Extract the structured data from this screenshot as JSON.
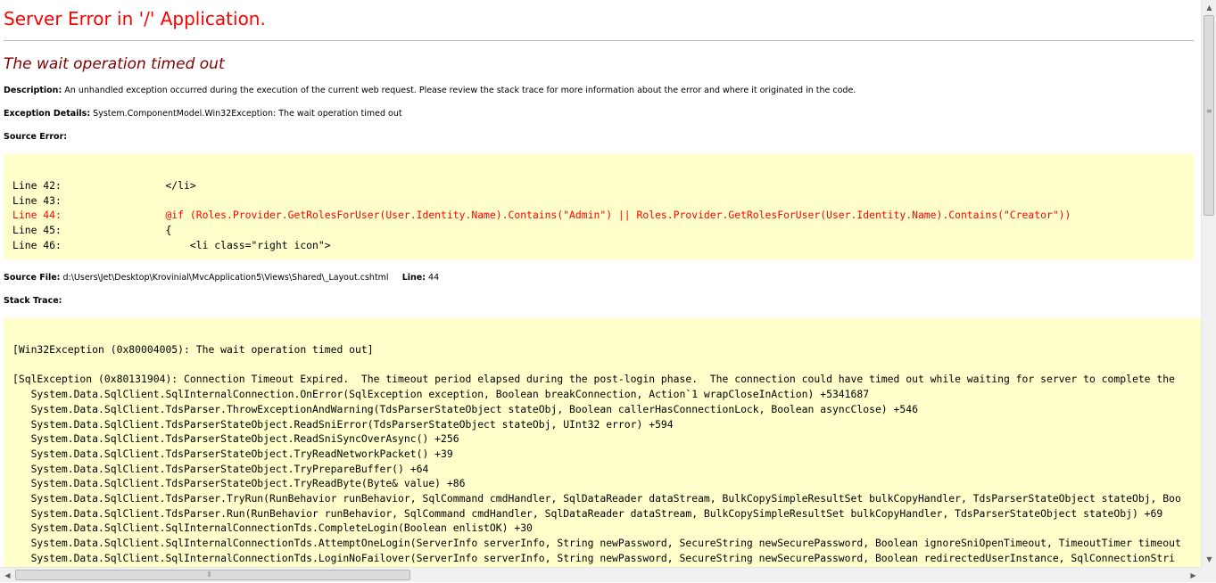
{
  "error": {
    "heading": "Server Error in '/' Application.",
    "subheading": "The wait operation timed out",
    "description_label": "Description:",
    "description_text": "An unhandled exception occurred during the execution of the current web request. Please review the stack trace for more information about the error and where it originated in the code.",
    "exception_label": "Exception Details:",
    "exception_text": "System.ComponentModel.Win32Exception: The wait operation timed out",
    "source_error_label": "Source Error:",
    "source_lines": [
      "Line 42:                 </li>",
      "Line 43:",
      "Line 44:                 @if (Roles.Provider.GetRolesForUser(User.Identity.Name).Contains(\"Admin\") || Roles.Provider.GetRolesForUser(User.Identity.Name).Contains(\"Creator\"))",
      "Line 45:                 {",
      "Line 46:                     <li class=\"right icon\">"
    ],
    "source_file_label": "Source File:",
    "source_file_path": "d:\\Users\\Jet\\Desktop\\Krovinial\\MvcApplication5\\Views\\Shared\\_Layout.cshtml",
    "line_label": "Line:",
    "line_number": "44",
    "stack_trace_label": "Stack Trace:",
    "stack_lines": [
      "[Win32Exception (0x80004005): The wait operation timed out]",
      "",
      "[SqlException (0x80131904): Connection Timeout Expired.  The timeout period elapsed during the post-login phase.  The connection could have timed out while waiting for server to complete the",
      "   System.Data.SqlClient.SqlInternalConnection.OnError(SqlException exception, Boolean breakConnection, Action`1 wrapCloseInAction) +5341687",
      "   System.Data.SqlClient.TdsParser.ThrowExceptionAndWarning(TdsParserStateObject stateObj, Boolean callerHasConnectionLock, Boolean asyncClose) +546",
      "   System.Data.SqlClient.TdsParserStateObject.ReadSniError(TdsParserStateObject stateObj, UInt32 error) +594",
      "   System.Data.SqlClient.TdsParserStateObject.ReadSniSyncOverAsync() +256",
      "   System.Data.SqlClient.TdsParserStateObject.TryReadNetworkPacket() +39",
      "   System.Data.SqlClient.TdsParserStateObject.TryPrepareBuffer() +64",
      "   System.Data.SqlClient.TdsParserStateObject.TryReadByte(Byte& value) +86",
      "   System.Data.SqlClient.TdsParser.TryRun(RunBehavior runBehavior, SqlCommand cmdHandler, SqlDataReader dataStream, BulkCopySimpleResultSet bulkCopyHandler, TdsParserStateObject stateObj, Boo",
      "   System.Data.SqlClient.TdsParser.Run(RunBehavior runBehavior, SqlCommand cmdHandler, SqlDataReader dataStream, BulkCopySimpleResultSet bulkCopyHandler, TdsParserStateObject stateObj) +69",
      "   System.Data.SqlClient.SqlInternalConnectionTds.CompleteLogin(Boolean enlistOK) +30",
      "   System.Data.SqlClient.SqlInternalConnectionTds.AttemptOneLogin(ServerInfo serverInfo, String newPassword, SecureString newSecurePassword, Boolean ignoreSniOpenTimeout, TimeoutTimer timeout",
      "   System.Data.SqlClient.SqlInternalConnectionTds.LoginNoFailover(ServerInfo serverInfo, String newPassword, SecureString newSecurePassword, Boolean redirectedUserInstance, SqlConnectionStri"
    ]
  },
  "scrollbars": {
    "up_arrow": "▲",
    "down_arrow": "▼",
    "left_arrow": "◀",
    "right_arrow": "▶",
    "grip": "≡",
    "hgrip": "⦀"
  },
  "colors": {
    "heading": "#ff0000",
    "subheading": "#800000",
    "code_background": "#ffffcc"
  }
}
